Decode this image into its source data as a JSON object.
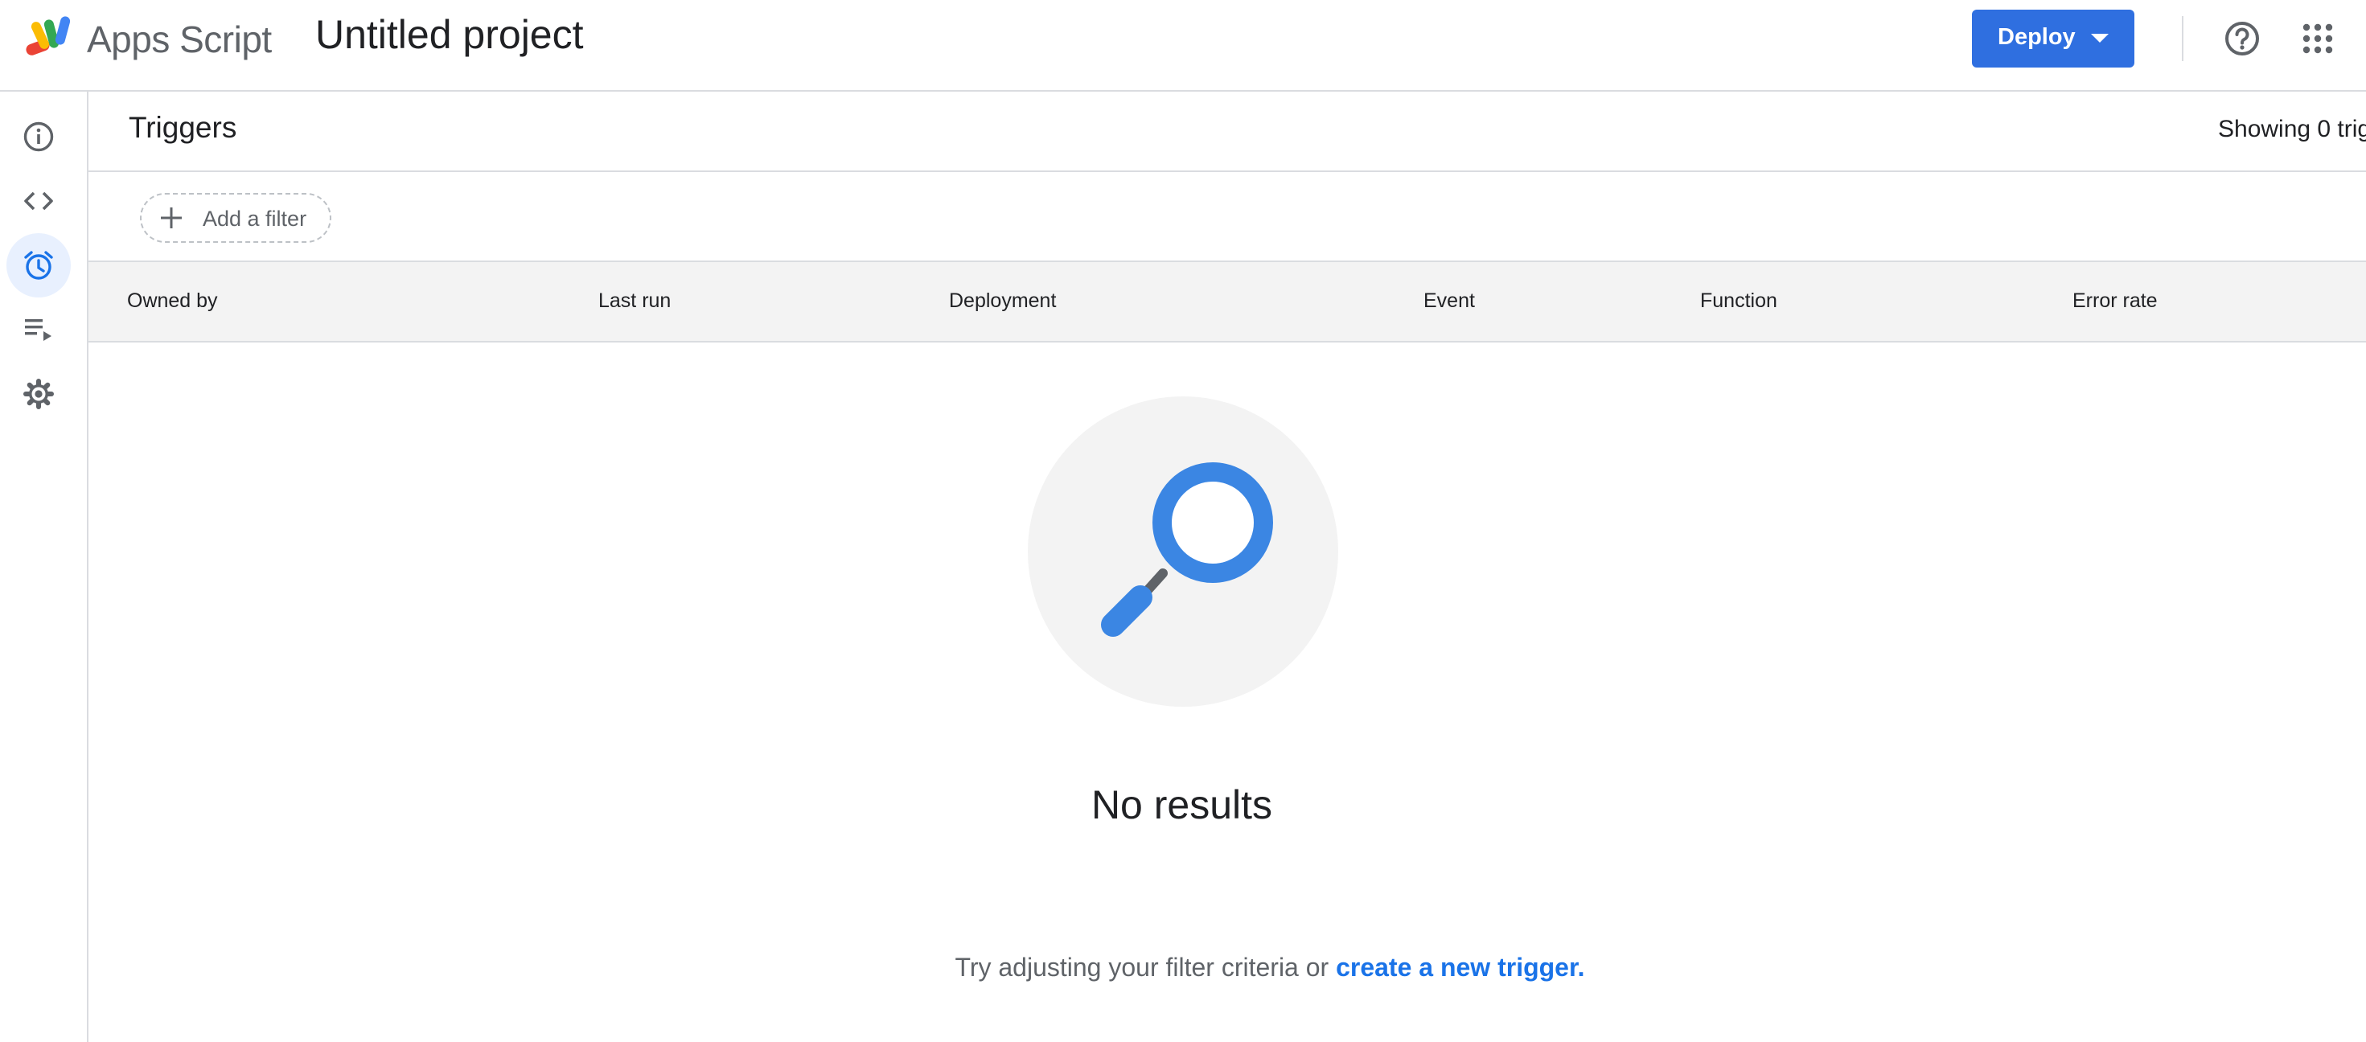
{
  "header": {
    "app_name": "Apps Script",
    "project_title": "Untitled project",
    "deploy_label": "Deploy",
    "help_icon": "help-circle-icon",
    "apps_icon": "apps-grid-icon",
    "logo_icon": "apps-script-logo"
  },
  "sidebar": {
    "items": [
      {
        "icon": "info-icon",
        "label": "Overview"
      },
      {
        "icon": "code-icon",
        "label": "Editor"
      },
      {
        "icon": "alarm-clock-icon",
        "label": "Triggers",
        "active": true
      },
      {
        "icon": "executions-icon",
        "label": "Executions"
      },
      {
        "icon": "gear-icon",
        "label": "Project Settings"
      }
    ]
  },
  "main": {
    "title": "Triggers",
    "showing_text": "Showing 0 trig",
    "filter": {
      "label": "Add a filter",
      "icon": "plus-icon"
    },
    "columns": [
      "Owned by",
      "Last run",
      "Deployment",
      "Event",
      "Function",
      "Error rate"
    ],
    "empty_state": {
      "icon": "magnifier-icon",
      "title": "No results",
      "message": "Try adjusting your filter criteria or",
      "link": "create a new trigger."
    }
  },
  "colors": {
    "accent": "#2f6fe0",
    "link": "#1a73e8",
    "active_nav_bg": "#e8f0fe",
    "header_bg": "#f3f3f3",
    "magnifier": "#3b86e3"
  }
}
